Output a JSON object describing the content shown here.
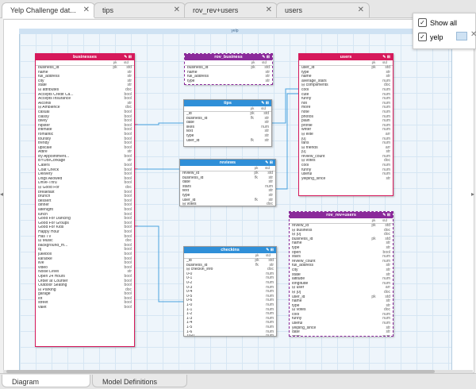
{
  "tabs": [
    {
      "label": "Yelp Challenge dat...",
      "active": true
    },
    {
      "label": "tips",
      "active": false
    },
    {
      "label": "rov_rev+users",
      "active": false
    },
    {
      "label": "users",
      "active": false
    }
  ],
  "diagram": {
    "title": "yelp"
  },
  "legend": {
    "show_all": "Show all",
    "item": "yelp",
    "swatch_color": "#cfe2f3"
  },
  "bottom_tabs": {
    "diagram": "Diagram",
    "model": "Model Definitions"
  },
  "colors": {
    "pink": "#d6195b",
    "purple": "#8a2a9a",
    "blue": "#2f8fd8",
    "line": "#4aa3df"
  },
  "tables": {
    "businesses": {
      "name": "businesses",
      "col_hdr": [
        "",
        "pk",
        "std"
      ],
      "rows": [
        [
          "business_id",
          "pk",
          "std"
        ],
        [
          "name",
          "",
          "str"
        ],
        [
          "full_address",
          "",
          "str"
        ],
        [
          "city",
          "",
          "str"
        ],
        [
          "state",
          "",
          "str"
        ],
        [
          "⊟ attributes",
          "",
          "doc"
        ],
        [
          "Accepts Credit Ca...",
          "",
          "bool"
        ],
        [
          "Accepts Insurance",
          "",
          "bool"
        ],
        [
          "Alcohol",
          "",
          "str"
        ],
        [
          "⊟ Ambience",
          "",
          "doc"
        ],
        [
          "casual",
          "",
          "bool"
        ],
        [
          "classy",
          "",
          "bool"
        ],
        [
          "divey",
          "",
          "bool"
        ],
        [
          "hipster",
          "",
          "bool"
        ],
        [
          "intimate",
          "",
          "bool"
        ],
        [
          "romantic",
          "",
          "bool"
        ],
        [
          "touristy",
          "",
          "bool"
        ],
        [
          "trendy",
          "",
          "bool"
        ],
        [
          "upscale",
          "",
          "bool"
        ],
        [
          "Attire",
          "",
          "str"
        ],
        [
          "By Appointment...",
          "",
          "bool"
        ],
        [
          "BYOB/Corkage",
          "",
          "str"
        ],
        [
          "Caters",
          "",
          "bool"
        ],
        [
          "Coat Check",
          "",
          "bool"
        ],
        [
          "Delivery",
          "",
          "bool"
        ],
        [
          "Dogs Allowed",
          "",
          "bool"
        ],
        [
          "Drive-Thru",
          "",
          "bool"
        ],
        [
          "⊟ Good For",
          "",
          "doc"
        ],
        [
          "breakfast",
          "",
          "bool"
        ],
        [
          "brunch",
          "",
          "bool"
        ],
        [
          "dessert",
          "",
          "bool"
        ],
        [
          "dinner",
          "",
          "bool"
        ],
        [
          "latenight",
          "",
          "bool"
        ],
        [
          "lunch",
          "",
          "bool"
        ],
        [
          "Good For Dancing",
          "",
          "bool"
        ],
        [
          "Good For Groups",
          "",
          "bool"
        ],
        [
          "Good For Kids",
          "",
          "bool"
        ],
        [
          "Happy Hour",
          "",
          "bool"
        ],
        [
          "Has TV",
          "",
          "bool"
        ],
        [
          "⊟ Music",
          "",
          "doc"
        ],
        [
          "background_m...",
          "",
          "bool"
        ],
        [
          "dj",
          "",
          "bool"
        ],
        [
          "jukebox",
          "",
          "bool"
        ],
        [
          "karaoke",
          "",
          "bool"
        ],
        [
          "live",
          "",
          "bool"
        ],
        [
          "video",
          "",
          "bool"
        ],
        [
          "Noise Level",
          "",
          "str"
        ],
        [
          "Open 24 Hours",
          "",
          "bool"
        ],
        [
          "Order at Counter",
          "",
          "bool"
        ],
        [
          "Outdoor Seating",
          "",
          "bool"
        ],
        [
          "⊟ Parking",
          "",
          "doc"
        ],
        [
          "garage",
          "",
          "bool"
        ],
        [
          "lot",
          "",
          "bool"
        ],
        [
          "street",
          "",
          "bool"
        ],
        [
          "valet",
          "",
          "bool"
        ]
      ]
    },
    "rov_business": {
      "name": "rov_business",
      "col_hdr": [
        "",
        "pk",
        "std"
      ],
      "rows": [
        [
          "business_id",
          "pk",
          "std"
        ],
        [
          "name",
          "",
          "str"
        ],
        [
          "full_address",
          "",
          "str"
        ],
        [
          "type",
          "",
          "str"
        ]
      ]
    },
    "users": {
      "name": "users",
      "col_hdr": [
        "",
        "pk",
        "std"
      ],
      "rows": [
        [
          "user_id",
          "pk",
          "std"
        ],
        [
          "type",
          "",
          "str"
        ],
        [
          "name",
          "",
          "str"
        ],
        [
          "average_stars",
          "",
          "num"
        ],
        [
          "⊟ compliments",
          "",
          "doc"
        ],
        [
          "cool",
          "",
          "num"
        ],
        [
          "cute",
          "",
          "num"
        ],
        [
          "funny",
          "",
          "num"
        ],
        [
          "hot",
          "",
          "num"
        ],
        [
          "more",
          "",
          "num"
        ],
        [
          "note",
          "",
          "num"
        ],
        [
          "photos",
          "",
          "num"
        ],
        [
          "plain",
          "",
          "num"
        ],
        [
          "profile",
          "",
          "num"
        ],
        [
          "writer",
          "",
          "num"
        ],
        [
          "⊟ elite",
          "",
          "arr"
        ],
        [
          "[0]",
          "",
          "num"
        ],
        [
          "fans",
          "",
          "num"
        ],
        [
          "⊟ friends",
          "",
          "arr"
        ],
        [
          "[0]",
          "",
          "str"
        ],
        [
          "review_count",
          "",
          "num"
        ],
        [
          "⊟ votes",
          "",
          "doc"
        ],
        [
          "cool",
          "",
          "num"
        ],
        [
          "funny",
          "",
          "num"
        ],
        [
          "useful",
          "",
          "num"
        ],
        [
          "yelping_since",
          "",
          "str"
        ]
      ]
    },
    "tips": {
      "name": "tips",
      "col_hdr": [
        "",
        "pk",
        "std"
      ],
      "rows": [
        [
          "_id",
          "pk",
          "std"
        ],
        [
          "business_id",
          "fk",
          "str"
        ],
        [
          "date",
          "",
          "str"
        ],
        [
          "likes",
          "",
          "num"
        ],
        [
          "text",
          "",
          "str"
        ],
        [
          "type",
          "",
          "str"
        ],
        [
          "user_id",
          "fk",
          "str"
        ]
      ]
    },
    "reviews": {
      "name": "reviews",
      "col_hdr": [
        "",
        "pk",
        "std"
      ],
      "rows": [
        [
          "review_id",
          "pk",
          "std"
        ],
        [
          "business_id",
          "fk",
          "str"
        ],
        [
          "date",
          "",
          "str"
        ],
        [
          "stars",
          "",
          "num"
        ],
        [
          "text",
          "",
          "str"
        ],
        [
          "type",
          "",
          "str"
        ],
        [
          "user_id",
          "fk",
          "str"
        ],
        [
          "⊟ votes",
          "",
          "doc"
        ],
        [
          "cool",
          "",
          "num"
        ],
        [
          "funny",
          "",
          "num"
        ],
        [
          "useful",
          "",
          "num"
        ]
      ]
    },
    "rov_rev_users": {
      "name": "rov_rev+users",
      "col_hdr": [
        "",
        "pk",
        "std"
      ],
      "rows": [
        [
          "review_id",
          "pk",
          "std"
        ],
        [
          "⊟ business",
          "",
          "doc"
        ],
        [
          "⊟ [0]",
          "",
          "doc"
        ],
        [
          "business_id",
          "pk",
          "std"
        ],
        [
          "name",
          "",
          "str"
        ],
        [
          "type",
          "",
          "str"
        ],
        [
          "open",
          "",
          "bool"
        ],
        [
          "stars",
          "",
          "num"
        ],
        [
          "review_count",
          "",
          "num"
        ],
        [
          "full_address",
          "",
          "str"
        ],
        [
          "city",
          "",
          "str"
        ],
        [
          "state",
          "",
          "str"
        ],
        [
          "latitude",
          "",
          "num"
        ],
        [
          "longitude",
          "",
          "num"
        ],
        [
          "⊟ user",
          "",
          "arr"
        ],
        [
          "⊟ [0]",
          "",
          "doc"
        ],
        [
          "user_id",
          "pk",
          "std"
        ],
        [
          "name",
          "",
          "str"
        ],
        [
          "type",
          "",
          "str"
        ],
        [
          "⊟ votes",
          "",
          "doc"
        ],
        [
          "cool",
          "",
          "num"
        ],
        [
          "funny",
          "",
          "num"
        ],
        [
          "useful",
          "",
          "num"
        ],
        [
          "yelping_since",
          "",
          "str"
        ],
        [
          "date",
          "",
          "str"
        ],
        [
          "stars",
          "",
          "num"
        ],
        [
          "type",
          "",
          "str"
        ]
      ]
    },
    "checkins": {
      "name": "checkins",
      "col_hdr": [
        "",
        "pk",
        "std"
      ],
      "rows": [
        [
          "_id",
          "pk",
          "std"
        ],
        [
          "business_id",
          "fk",
          "str"
        ],
        [
          "⊟ checkin_info",
          "",
          "doc"
        ],
        [
          "0-0",
          "",
          "num"
        ],
        [
          "0-1",
          "",
          "num"
        ],
        [
          "0-2",
          "",
          "num"
        ],
        [
          "0-3",
          "",
          "num"
        ],
        [
          "0-4",
          "",
          "num"
        ],
        [
          "0-5",
          "",
          "num"
        ],
        [
          "0-6",
          "",
          "num"
        ],
        [
          "1-0",
          "",
          "num"
        ],
        [
          "1-1",
          "",
          "num"
        ],
        [
          "1-2",
          "",
          "num"
        ],
        [
          "1-3",
          "",
          "num"
        ],
        [
          "1-4",
          "",
          "num"
        ],
        [
          "1-5",
          "",
          "num"
        ],
        [
          "1-6",
          "",
          "num"
        ],
        [
          "10-0",
          "",
          "num"
        ],
        [
          "10-1",
          "",
          "num"
        ],
        [
          "10-2",
          "",
          "num"
        ]
      ]
    }
  }
}
